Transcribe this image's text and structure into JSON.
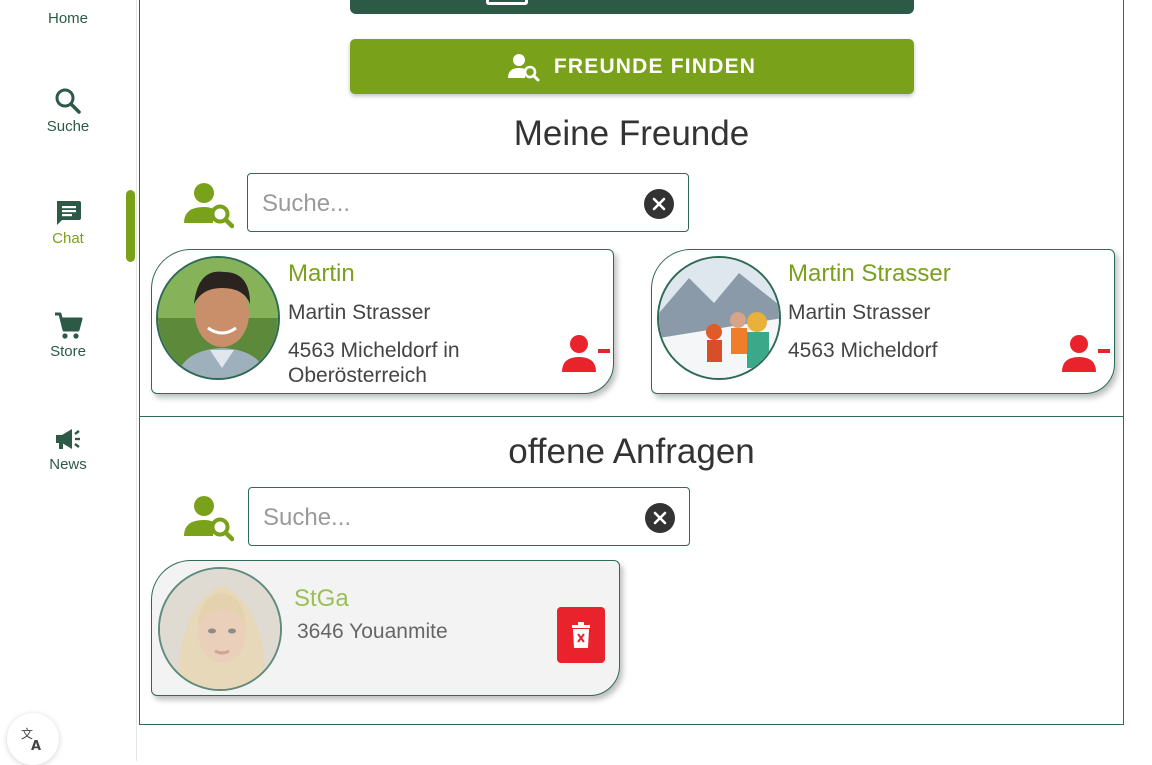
{
  "sidebar": {
    "items": [
      {
        "label": "Home",
        "icon": "home-icon"
      },
      {
        "label": "Suche",
        "icon": "search-icon"
      },
      {
        "label": "Chat",
        "icon": "chat-icon"
      },
      {
        "label": "Store",
        "icon": "cart-icon"
      },
      {
        "label": "News",
        "icon": "megaphone-icon"
      }
    ],
    "active": "Chat",
    "translate_icon": "translate-icon"
  },
  "actions": {
    "find_friends_label": "FREUNDE FINDEN"
  },
  "friends": {
    "title": "Meine Freunde",
    "search_placeholder": "Suche...",
    "items": [
      {
        "name": "Martin",
        "fullname": "Martin Strasser",
        "location": "4563 Micheldorf in Oberösterreich"
      },
      {
        "name": "Martin Strasser",
        "fullname": "Martin Strasser",
        "location": "4563 Micheldorf"
      }
    ]
  },
  "requests": {
    "title": "offene Anfragen",
    "search_placeholder": "Suche...",
    "items": [
      {
        "name": "StGa",
        "location": "3646 Youanmite"
      }
    ]
  },
  "colors": {
    "brand_green": "#7aa11a",
    "dark_green": "#2d5a47",
    "danger_red": "#e8232b"
  }
}
